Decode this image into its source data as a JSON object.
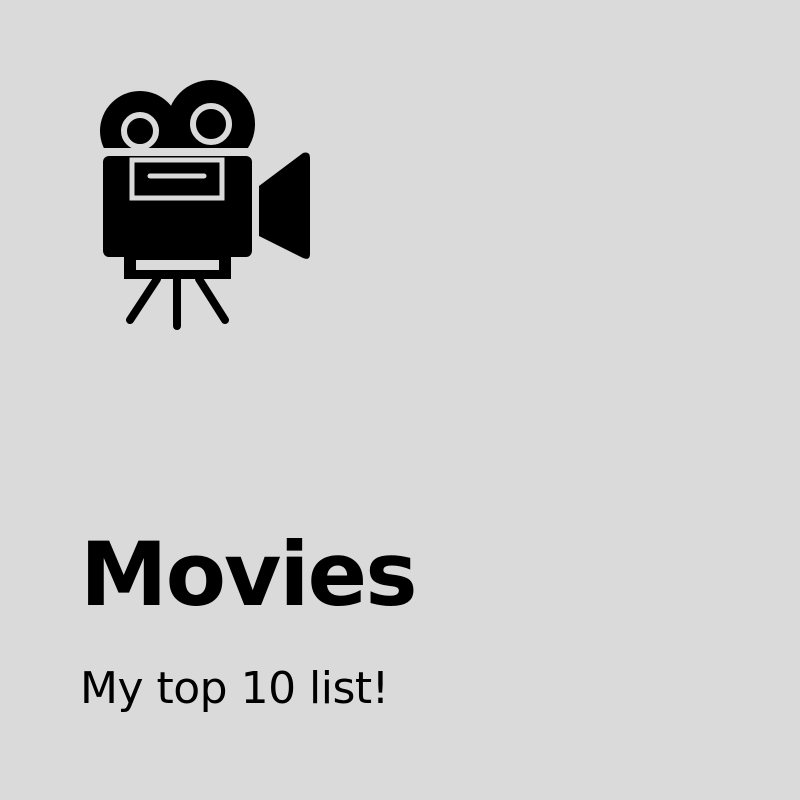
{
  "card": {
    "icon": "movie-camera-icon",
    "title": "Movies",
    "subtitle": "My top 10 list!"
  },
  "colors": {
    "background": "#dadada",
    "foreground": "#000000"
  }
}
